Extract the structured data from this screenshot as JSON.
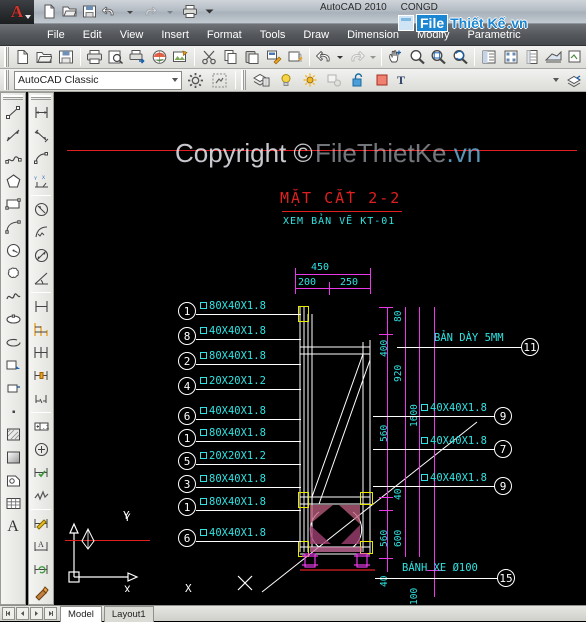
{
  "window": {
    "app_title": "AutoCAD 2010",
    "document_title": "CONGD",
    "logo_letter": "A"
  },
  "watermark": {
    "copyright_text": "Copyright ©",
    "site_text": "FileThietKe",
    "site_tld": ".vn",
    "logo_file": "File",
    "logo_thiet_ke": "Thiết Kế",
    "logo_vn": ".vn"
  },
  "quick_access": {
    "items": [
      {
        "name": "new-file-icon",
        "label": "New"
      },
      {
        "name": "open-file-icon",
        "label": "Open"
      },
      {
        "name": "save-icon",
        "label": "Save"
      },
      {
        "name": "undo-icon",
        "label": "Undo"
      },
      {
        "name": "redo-icon",
        "label": "Redo"
      },
      {
        "name": "plot-icon",
        "label": "Plot"
      },
      {
        "name": "chevron-down-icon",
        "label": "Customize"
      }
    ]
  },
  "menubar": {
    "items": [
      {
        "label": "File"
      },
      {
        "label": "Edit"
      },
      {
        "label": "View"
      },
      {
        "label": "Insert"
      },
      {
        "label": "Format"
      },
      {
        "label": "Tools"
      },
      {
        "label": "Draw"
      },
      {
        "label": "Dimension"
      },
      {
        "label": "Modify"
      },
      {
        "label": "Parametric"
      }
    ]
  },
  "standard_toolbar": {
    "items": [
      {
        "name": "new-icon"
      },
      {
        "name": "open-icon"
      },
      {
        "name": "save-icon"
      },
      {
        "name": "plot-icon"
      },
      {
        "name": "plot-preview-icon"
      },
      {
        "name": "publish-icon"
      },
      {
        "name": "3dwalk-icon"
      },
      {
        "name": "export-icon"
      },
      {
        "name": "cut-icon"
      },
      {
        "name": "copy-icon"
      },
      {
        "name": "paste-icon"
      },
      {
        "name": "match-properties-icon"
      },
      {
        "name": "block-editor-icon"
      },
      {
        "name": "undo-icon"
      },
      {
        "name": "redo-icon"
      },
      {
        "name": "pan-icon"
      },
      {
        "name": "zoom-icon"
      },
      {
        "name": "zoom-window-icon"
      },
      {
        "name": "zoom-previous-icon"
      },
      {
        "name": "properties-icon"
      },
      {
        "name": "designcenter-icon"
      },
      {
        "name": "tool-palettes-icon"
      },
      {
        "name": "sheet-set-icon"
      },
      {
        "name": "markup-icon"
      }
    ]
  },
  "workspace": {
    "label": "AutoCAD Classic",
    "gear_icon": "workspace-settings-icon",
    "display_icon": "workspace-display-icon"
  },
  "layer_toolbar": {
    "layer_properties_icon": "layer-properties-icon",
    "bulb_icon": "layer-on-icon",
    "sun_icon": "layer-thaw-icon",
    "freeze_icon": "layer-freeze-vp-icon",
    "lock_icon": "layer-unlock-icon",
    "color_swatch": "#f08070",
    "current_layer": "T",
    "layer_previous_icon": "layer-previous-icon"
  },
  "draw_toolbar": {
    "items": [
      {
        "name": "line-icon"
      },
      {
        "name": "construction-line-icon"
      },
      {
        "name": "polyline-icon"
      },
      {
        "name": "polygon-icon"
      },
      {
        "name": "rectangle-icon"
      },
      {
        "name": "arc-icon"
      },
      {
        "name": "circle-icon"
      },
      {
        "name": "revcloud-icon"
      },
      {
        "name": "spline-icon"
      },
      {
        "name": "ellipse-icon"
      },
      {
        "name": "ellipse-arc-icon"
      },
      {
        "name": "insert-block-icon"
      },
      {
        "name": "make-block-icon"
      },
      {
        "name": "point-icon"
      },
      {
        "name": "hatch-icon"
      },
      {
        "name": "gradient-icon"
      },
      {
        "name": "region-icon"
      },
      {
        "name": "table-icon"
      },
      {
        "name": "multiline-text-icon"
      }
    ]
  },
  "dimension_toolbar": {
    "items": [
      {
        "name": "linear-dimension-icon"
      },
      {
        "name": "aligned-dimension-icon"
      },
      {
        "name": "arc-length-dimension-icon"
      },
      {
        "name": "ordinate-dimension-icon"
      },
      {
        "name": "radius-dimension-icon"
      },
      {
        "name": "jogged-dimension-icon"
      },
      {
        "name": "diameter-dimension-icon"
      },
      {
        "name": "angular-dimension-icon"
      },
      {
        "name": "quick-dimension-icon"
      },
      {
        "name": "baseline-dimension-icon"
      },
      {
        "name": "continue-dimension-icon"
      },
      {
        "name": "dimension-space-icon"
      },
      {
        "name": "dimension-break-icon"
      },
      {
        "name": "tolerance-icon"
      },
      {
        "name": "center-mark-icon"
      },
      {
        "name": "inspection-icon"
      },
      {
        "name": "jogged-linear-icon"
      },
      {
        "name": "dimension-edit-icon"
      },
      {
        "name": "dimension-text-edit-icon"
      },
      {
        "name": "dimension-update-icon"
      },
      {
        "name": "dimension-style-icon"
      }
    ]
  },
  "drawing": {
    "title": "MẶT  CẮT  2-2",
    "subtitle": "XEM  BẢN VẼ  KT-01",
    "top_dimensions": [
      {
        "value": "450"
      },
      {
        "value": "200"
      },
      {
        "value": "250"
      }
    ],
    "vertical_dimensions": [
      {
        "value": "80"
      },
      {
        "value": "400"
      },
      {
        "value": "920"
      },
      {
        "value": "560"
      },
      {
        "value": "1600"
      },
      {
        "value": "40"
      },
      {
        "value": "560"
      },
      {
        "value": "600"
      },
      {
        "value": "40"
      },
      {
        "value": "100"
      }
    ],
    "left_callouts": [
      {
        "num": "1",
        "label": "80X40X1.8"
      },
      {
        "num": "8",
        "label": "40X40X1.8"
      },
      {
        "num": "2",
        "label": "80X40X1.8"
      },
      {
        "num": "4",
        "label": "20X20X1.2"
      },
      {
        "num": "6",
        "label": "40X40X1.8"
      },
      {
        "num": "1",
        "label": "80X40X1.8"
      },
      {
        "num": "5",
        "label": "20X20X1.2"
      },
      {
        "num": "3",
        "label": "80X40X1.8"
      },
      {
        "num": "1",
        "label": "80X40X1.8"
      },
      {
        "num": "6",
        "label": "40X40X1.8"
      }
    ],
    "right_callouts": [
      {
        "num": "11",
        "label": "BẢN DÀY  5MM",
        "boxed": false
      },
      {
        "num": "9",
        "label": "40X40X1.8",
        "boxed": true
      },
      {
        "num": "7",
        "label": "40X40X1.8",
        "boxed": true
      },
      {
        "num": "9",
        "label": "40X40X1.8",
        "boxed": true
      },
      {
        "num": "15",
        "label": "BÁNH XE Ø100",
        "boxed": false
      }
    ],
    "ucs": {
      "x_label": "X",
      "y_label": "Y"
    },
    "colors": {
      "title_red": "#e02020",
      "text_cyan": "#2fe3e3",
      "dimension_magenta": "#e838e8",
      "geometry_white": "#ffffff",
      "steel_yellow": "#e8e800",
      "background": "#000000"
    }
  },
  "statusbar": {
    "tabs": [
      {
        "label": "Model",
        "active": true
      },
      {
        "label": "Layout1",
        "active": false
      }
    ],
    "nav_buttons": [
      "first-layout-icon",
      "prev-layout-icon",
      "next-layout-icon",
      "last-layout-icon"
    ]
  }
}
